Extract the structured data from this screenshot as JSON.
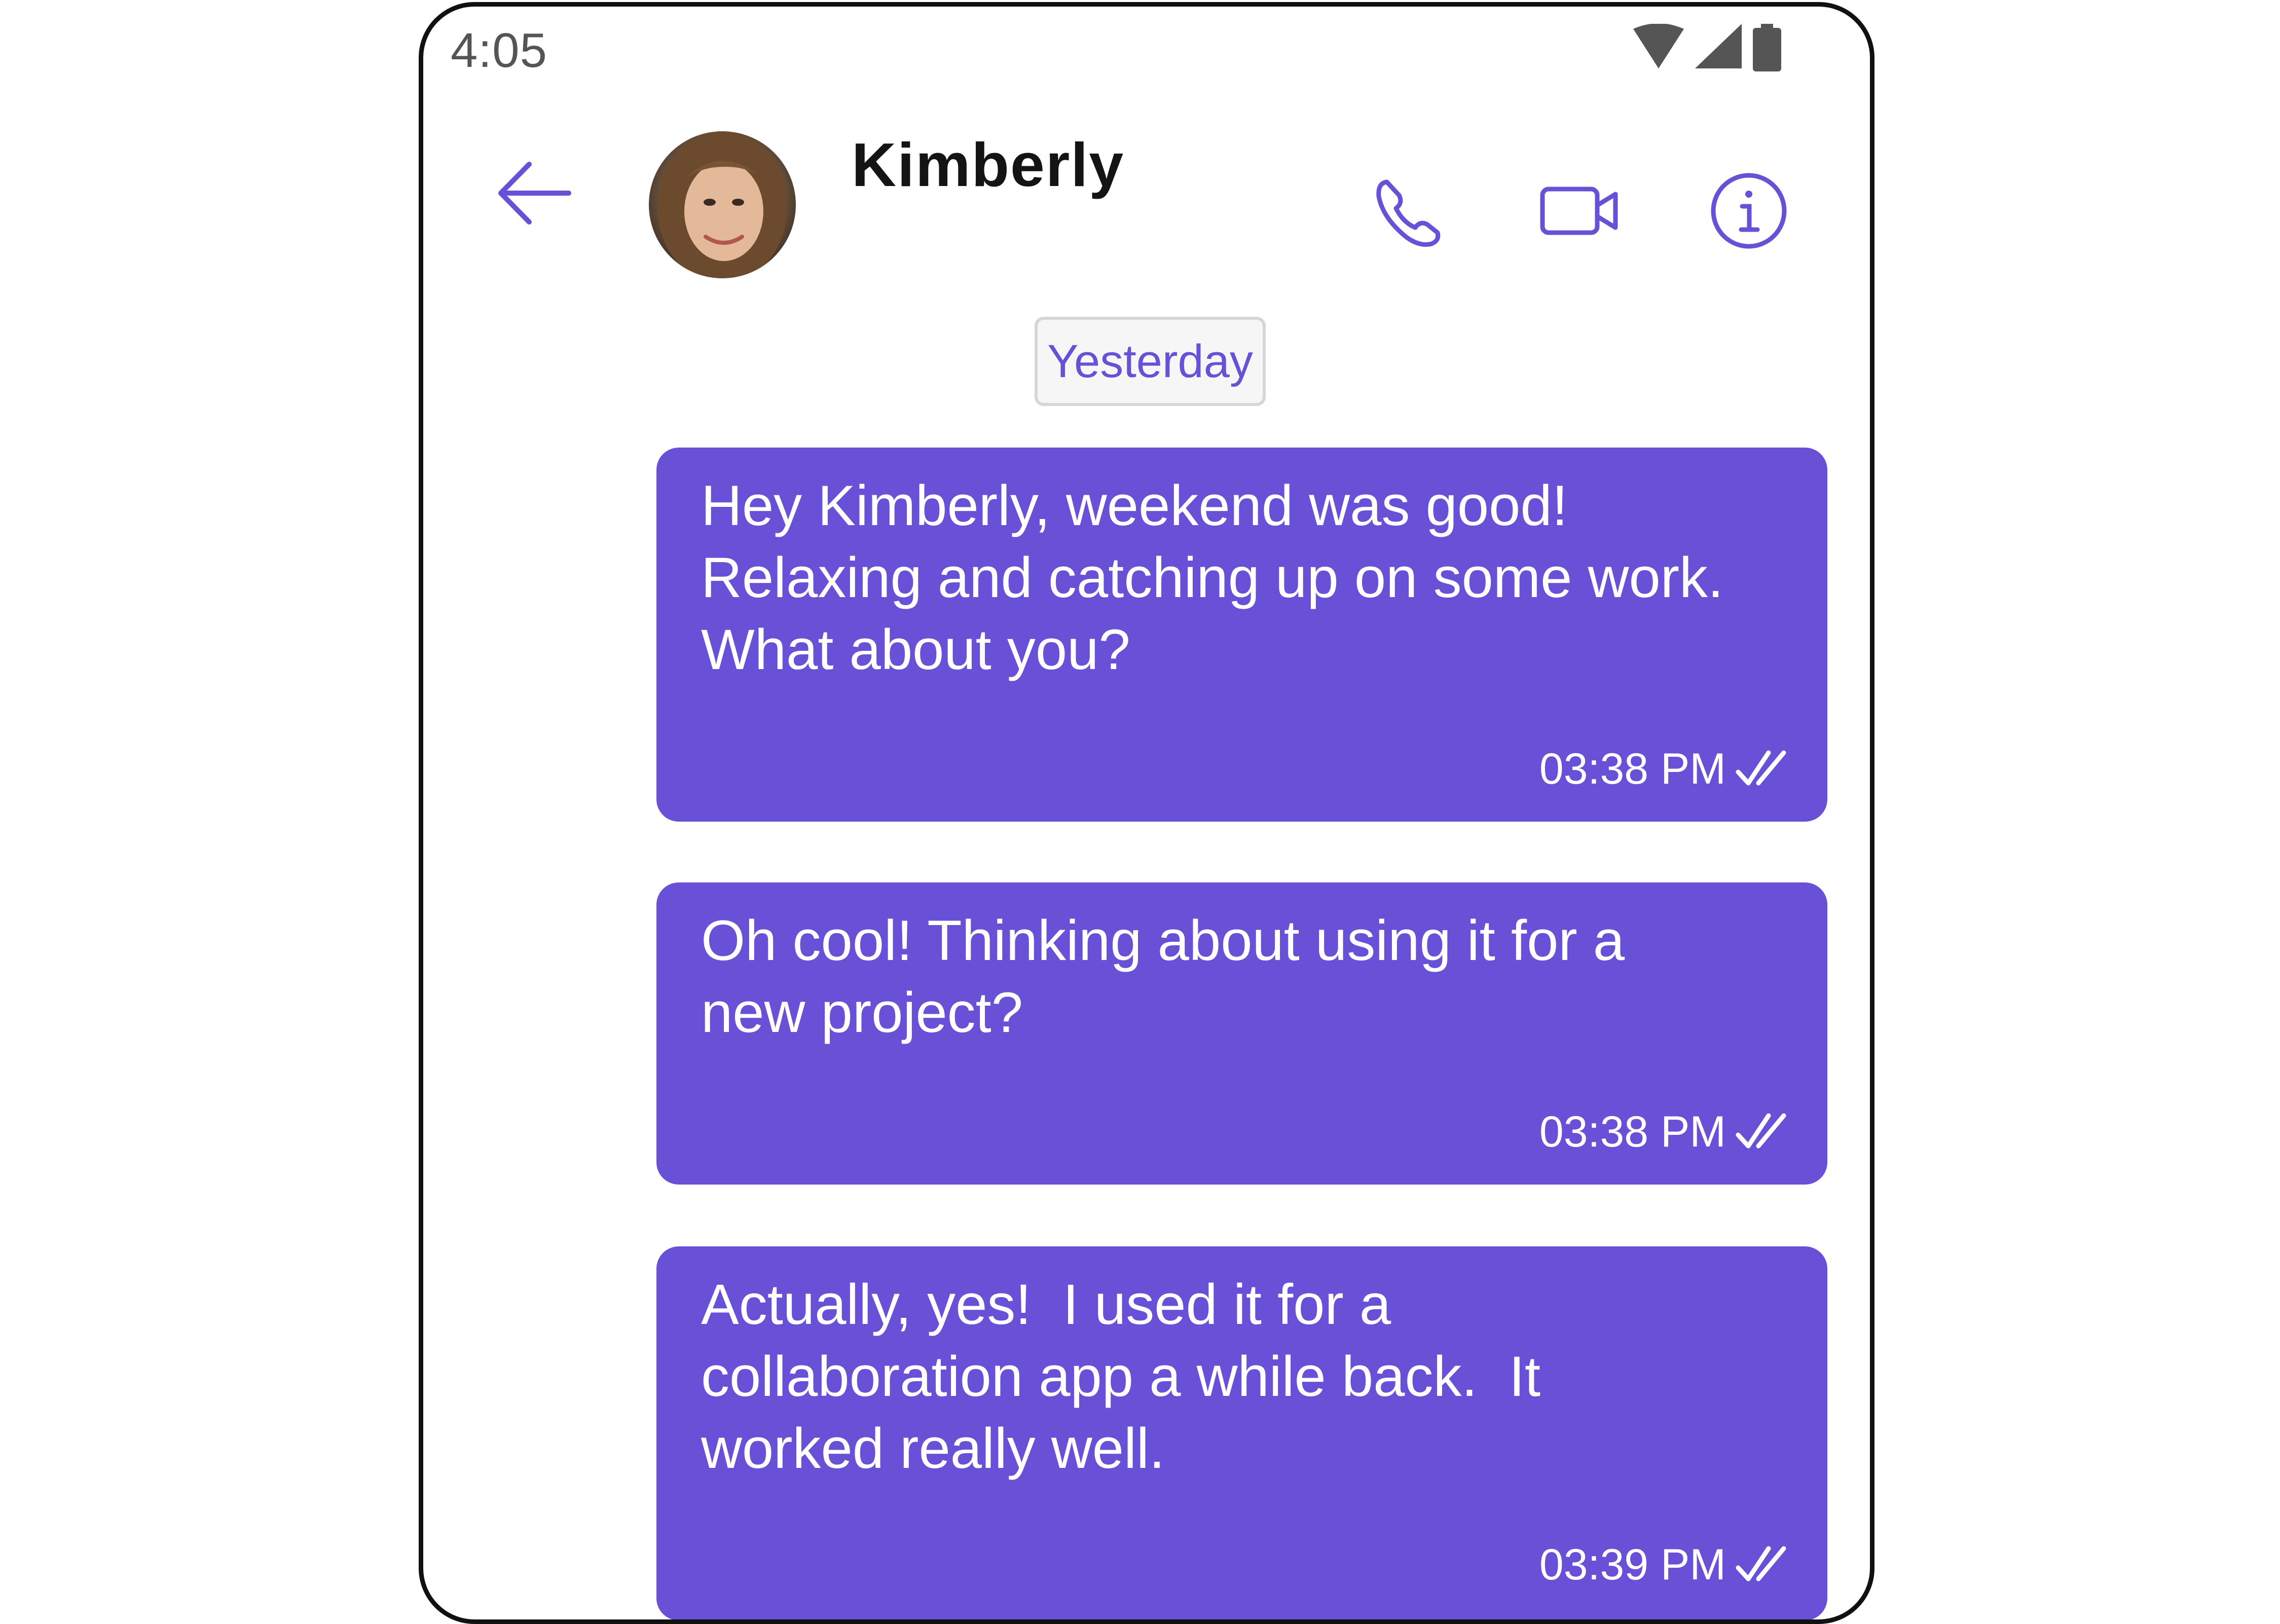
{
  "status_bar": {
    "time": "4:05",
    "icons": [
      "wifi-icon",
      "cell-signal-icon",
      "battery-icon"
    ]
  },
  "header": {
    "contact_name": "Kimberly",
    "back_icon": "arrow-left-icon",
    "actions": [
      "phone-call-icon",
      "video-call-icon",
      "info-icon"
    ]
  },
  "conversation": {
    "date_separator": "Yesterday",
    "messages": [
      {
        "text": "Hey Kimberly, weekend was good!\nRelaxing and catching up on some work.\nWhat about you?",
        "time": "03:38 PM",
        "status": "read"
      },
      {
        "text": "Oh cool! Thinking about using it for a\nnew project?",
        "time": "03:38 PM",
        "status": "read"
      },
      {
        "text": "Actually, yes!  I used it for a\ncollaboration app a while back.  It\nworked really well.",
        "time": "03:39 PM",
        "status": "read"
      }
    ]
  },
  "colors": {
    "accent": "#6851d6",
    "bubble_text": "#ffffff",
    "name_text": "#141414",
    "status_text": "#555555"
  }
}
